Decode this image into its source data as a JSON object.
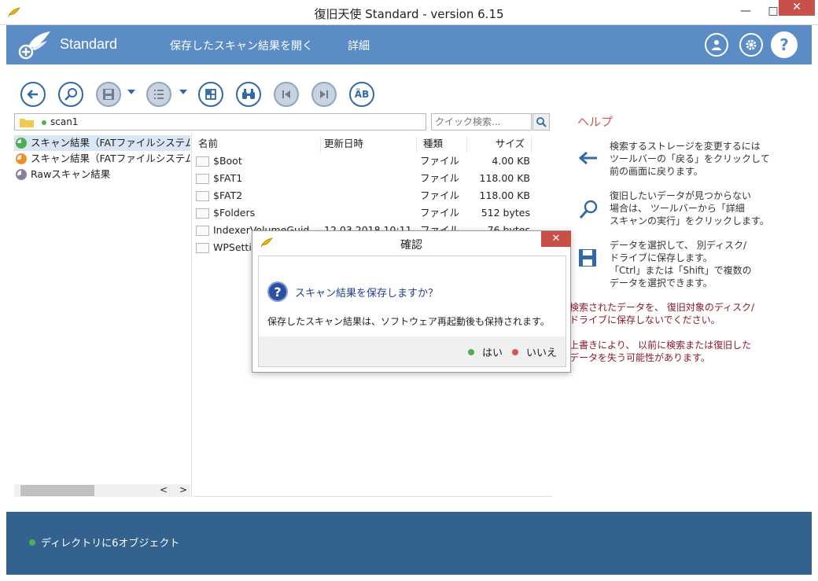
{
  "window": {
    "title": "復旧天使 Standard - version 6.15",
    "minimize": "—",
    "maximize": "□",
    "close": "✕"
  },
  "header": {
    "brand": "Standard",
    "nav": [
      "保存したスキャン結果を開く",
      "詳細"
    ],
    "help_symbol": "?"
  },
  "path": {
    "text": "scan1",
    "search_placeholder": "クイック検索..."
  },
  "tree": {
    "items": [
      {
        "label": "スキャン結果（FATファイルシステム",
        "color": "#4caf50"
      },
      {
        "label": "スキャン結果（FATファイルシステム",
        "color": "#f0902a"
      },
      {
        "label": "Rawスキャン結果",
        "color": "#8a7f9e"
      }
    ],
    "scroll_left": "<",
    "scroll_right": ">"
  },
  "list": {
    "columns": [
      "名前",
      "更新日時",
      "種類",
      "サイズ"
    ],
    "rows": [
      {
        "name": "$Boot",
        "date": "",
        "type": "ファイル",
        "size": "4.00 KB"
      },
      {
        "name": "$FAT1",
        "date": "",
        "type": "ファイル",
        "size": "118.00 KB"
      },
      {
        "name": "$FAT2",
        "date": "",
        "type": "ファイル",
        "size": "118.00 KB"
      },
      {
        "name": "$Folders",
        "date": "",
        "type": "ファイル",
        "size": "512 bytes"
      },
      {
        "name": "IndexerVolumeGuid",
        "date": "12.03.2018 10:11",
        "type": "ファイル",
        "size": "76 bytes"
      },
      {
        "name": "WPSettings",
        "date": "",
        "type": "",
        "size": ""
      }
    ]
  },
  "help": {
    "title": "ヘルプ",
    "items": [
      "検索するストレージを変更するには\nツールバーの「戻る」をクリックして\n前の画面に戻ります。",
      "復旧したいデータが見つからない\n場合は、 ツールバーから「詳細\nスキャンの実行」をクリックします。",
      "データを選択して、 別ディスク/\nドライブに保存します。\n「Ctrl」または「Shift」で複数の\nデータを選択できます。"
    ],
    "warning1": "検索されたデータを、 復旧対象のディスク/\nドライブに保存しないでください。",
    "warning2": "上書きにより、 以前に検索または復旧した\nデータを失う可能性があります。"
  },
  "status": {
    "text": "ディレクトリに6オブジェクト"
  },
  "dialog": {
    "title": "確認",
    "close": "✕",
    "question": "スキャン結果を保存しますか？",
    "message": "保存したスキャン結果は、ソフトウェア再起動後も保持されます。",
    "yes": "はい",
    "no": "いいえ",
    "question_symbol": "?"
  },
  "toolbar": {
    "sort_label": "ÄB"
  },
  "colors": {
    "header": "#5b8cc6",
    "status": "#33628f",
    "accent": "#2f6aa6",
    "help_title": "#d9534f",
    "warning": "#8b1a2b"
  }
}
